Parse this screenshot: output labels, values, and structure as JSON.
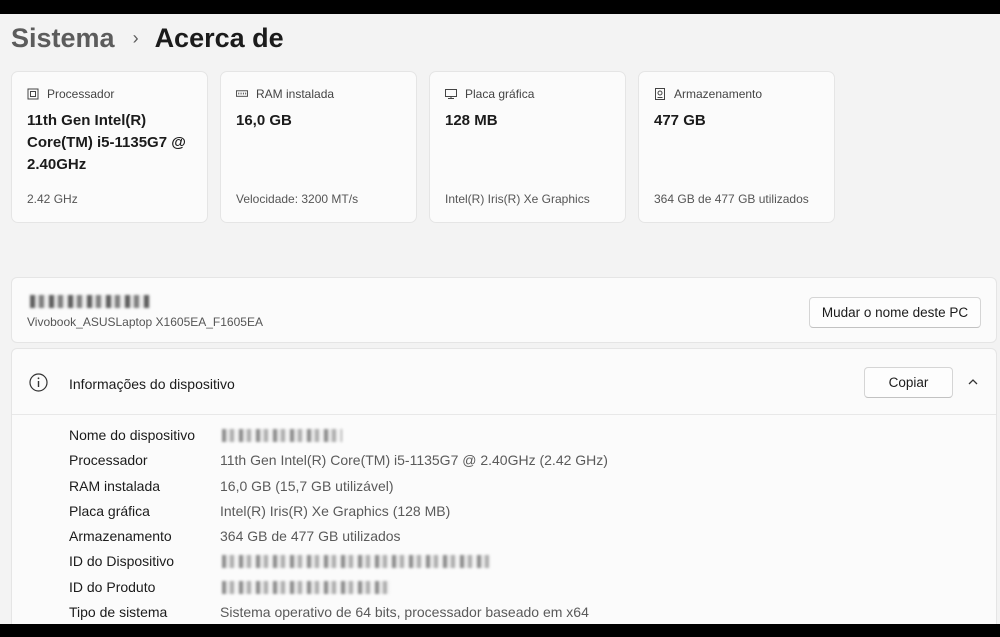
{
  "breadcrumb": {
    "parent": "Sistema",
    "separator": "›",
    "current": "Acerca de"
  },
  "cards": [
    {
      "title": "Processador",
      "icon": "cpu-icon",
      "value": "11th Gen Intel(R) Core(TM) i5-1135G7 @ 2.40GHz",
      "sub": "2.42 GHz"
    },
    {
      "title": "RAM instalada",
      "icon": "ram-icon",
      "value": "16,0 GB",
      "sub": "Velocidade: 3200 MT/s"
    },
    {
      "title": "Placa gráfica",
      "icon": "gpu-icon",
      "value": "128 MB",
      "sub": "Intel(R) Iris(R) Xe Graphics"
    },
    {
      "title": "Armazenamento",
      "icon": "storage-icon",
      "value": "477 GB",
      "sub": "364 GB de 477 GB utilizados"
    }
  ],
  "pc": {
    "model": "Vivobook_ASUSLaptop X1605EA_F1605EA",
    "rename_label": "Mudar o nome deste PC"
  },
  "device_info": {
    "title": "Informações do dispositivo",
    "copy_label": "Copiar",
    "rows": [
      {
        "label": "Nome do dispositivo",
        "value": ""
      },
      {
        "label": "Processador",
        "value": "11th Gen Intel(R) Core(TM) i5-1135G7 @ 2.40GHz (2.42 GHz)"
      },
      {
        "label": "RAM instalada",
        "value": "16,0 GB (15,7 GB utilizável)"
      },
      {
        "label": "Placa gráfica",
        "value": "Intel(R) Iris(R) Xe Graphics (128 MB)"
      },
      {
        "label": "Armazenamento",
        "value": "364 GB de 477 GB utilizados"
      },
      {
        "label": "ID do Dispositivo",
        "value": ""
      },
      {
        "label": "ID do Produto",
        "value": ""
      },
      {
        "label": "Tipo de sistema",
        "value": "Sistema operativo de 64 bits, processador baseado em x64"
      }
    ]
  }
}
